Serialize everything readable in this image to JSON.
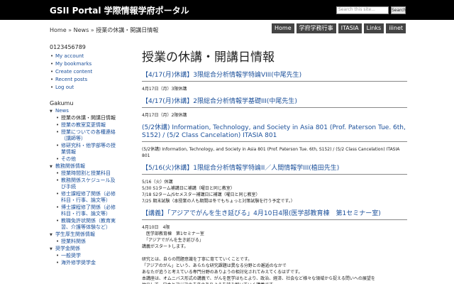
{
  "header": {
    "site_title": "GSII Portal 学際情報学府ポータル",
    "search_placeholder": "Search this site...",
    "search_button": "Search"
  },
  "breadcrumb": [
    "Home",
    "News",
    "授業の休講・開講日情報"
  ],
  "breadcrumb_sep": "»",
  "nav_tabs": [
    "Home",
    "学府学務行事",
    "ITASIA",
    "Links",
    "iiinet"
  ],
  "sidebar": {
    "username": "0123456789",
    "user_links": [
      "My account",
      "My bookmarks",
      "Create content",
      "Recent posts",
      "Log out"
    ],
    "section_title": "Gakumu",
    "tree": [
      {
        "label": "News",
        "level": 0
      },
      {
        "label": "授業の休講・開講日情報",
        "level": 1,
        "current": true
      },
      {
        "label": "授業の教室変更情報",
        "level": 1
      },
      {
        "label": "授業についての各種連絡（講師等）",
        "level": 1
      },
      {
        "label": "修研究科・他学部等の授業情報",
        "level": 1
      },
      {
        "label": "その他",
        "level": 1
      },
      {
        "label": "教務関係情報",
        "level": 0
      },
      {
        "label": "授業時間割と授業科目",
        "level": 1
      },
      {
        "label": "教務関係スケジュール及び手続",
        "level": 1
      },
      {
        "label": "修士課程修了関係（必修科目・行事、論文等）",
        "level": 1
      },
      {
        "label": "博士課程修了関係（必修科目・行事、論文等）",
        "level": 1
      },
      {
        "label": "教職免許状関係（教育実習、介護等体験など）",
        "level": 1
      },
      {
        "label": "学生厚生関係情報",
        "level": 0
      },
      {
        "label": "授業料関係",
        "level": 1
      },
      {
        "label": "奨学金関係",
        "level": 0
      },
      {
        "label": "一般奨学",
        "level": 1
      },
      {
        "label": "海外修学奨学金",
        "level": 1
      }
    ]
  },
  "main": {
    "page_title": "授業の休講・開講日情報",
    "posts": [
      {
        "title": "【4/17(月)休講】3限総合分析情報学特論VIII(中尾先生)",
        "body": "4月17日（月）3限休講"
      },
      {
        "title": "【4/17(月)休講】2限総合分析情報学基礎III(中尾先生)",
        "body": "4月17日（月）2限休講"
      },
      {
        "title": "(5/2休講) Information, Technology, and Society in Asia 801 (Prof. Paterson Tue. 6th, S152) / (5/2 Class Cancelation) ITASIA 801",
        "body": "(5/2休講) Information, Technology, and Society in Asia 801 (Prof. Paterson Tue. 6th, S152) / (5/2 Class Cancelation) ITASIA 801"
      },
      {
        "title": "【5/16(火)休講】1限総合分析情報学特論II／人間情報学III(植田先生)",
        "body": "5/16（火）休講\n5/30 S1ターム補講日に補講（曜日と同じ教室）\n7/18 S2ターム/Sセメスター補講日に補講（曜日と同じ教室）\n7/25 期末試験（本授業の人も期間は冬でもちょっと対策試験を行う予定です。）"
      },
      {
        "title": "【講義】「アジアでがんを生き延びる」4月10日4限(医学部教育棟　第1セミナー室)",
        "body": "4月10日　4限\n　医学部教育棟　第1セミナー室\n　「アジアでがんを生き延びる」\n講義がスタートします。\n\n研究とは、自らの問題意識を丁寧に育てていくことです。\n「アジアのがん」という、あらたな研究課題は異なる分野との邂逅のなかで\nあなたが追うと考えている専門分野のありようの相対化されてみえてくるはずです。\n本講座は、オムニバス形式の講義で、がんを医学はもとより、政治、経済、社会など様々な領域から捉える問いへの展望を\n抽出して、日本とアジアの未来のありようを読み解いていく講義です。"
      }
    ]
  }
}
